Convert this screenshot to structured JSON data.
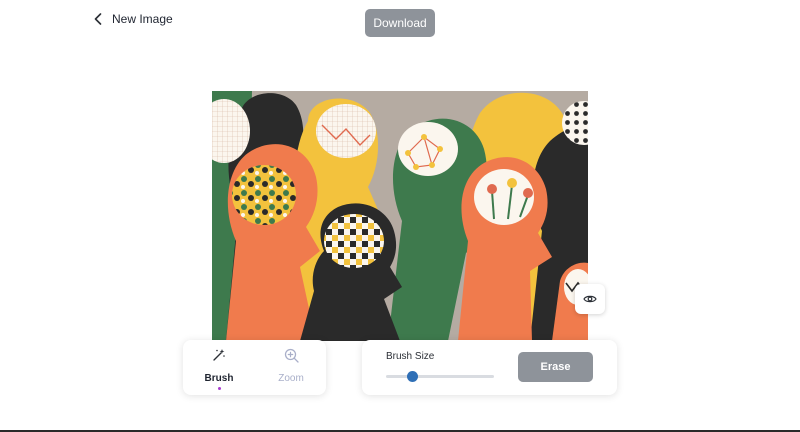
{
  "header": {
    "back_label": "New Image",
    "download_label": "Download"
  },
  "toolbar": {
    "tools": [
      {
        "label": "Brush",
        "icon": "magic-wand-icon",
        "active": true
      },
      {
        "label": "Zoom",
        "icon": "zoom-in-icon",
        "active": false
      }
    ]
  },
  "brush_settings": {
    "label": "Brush Size",
    "value_fraction": 0.24,
    "erase_label": "Erase"
  },
  "colors": {
    "button_gray": "#8e939a",
    "slider_thumb": "#2f6fb6",
    "active_dot": "#a83ccf",
    "inactive_label": "#a9afc9"
  }
}
